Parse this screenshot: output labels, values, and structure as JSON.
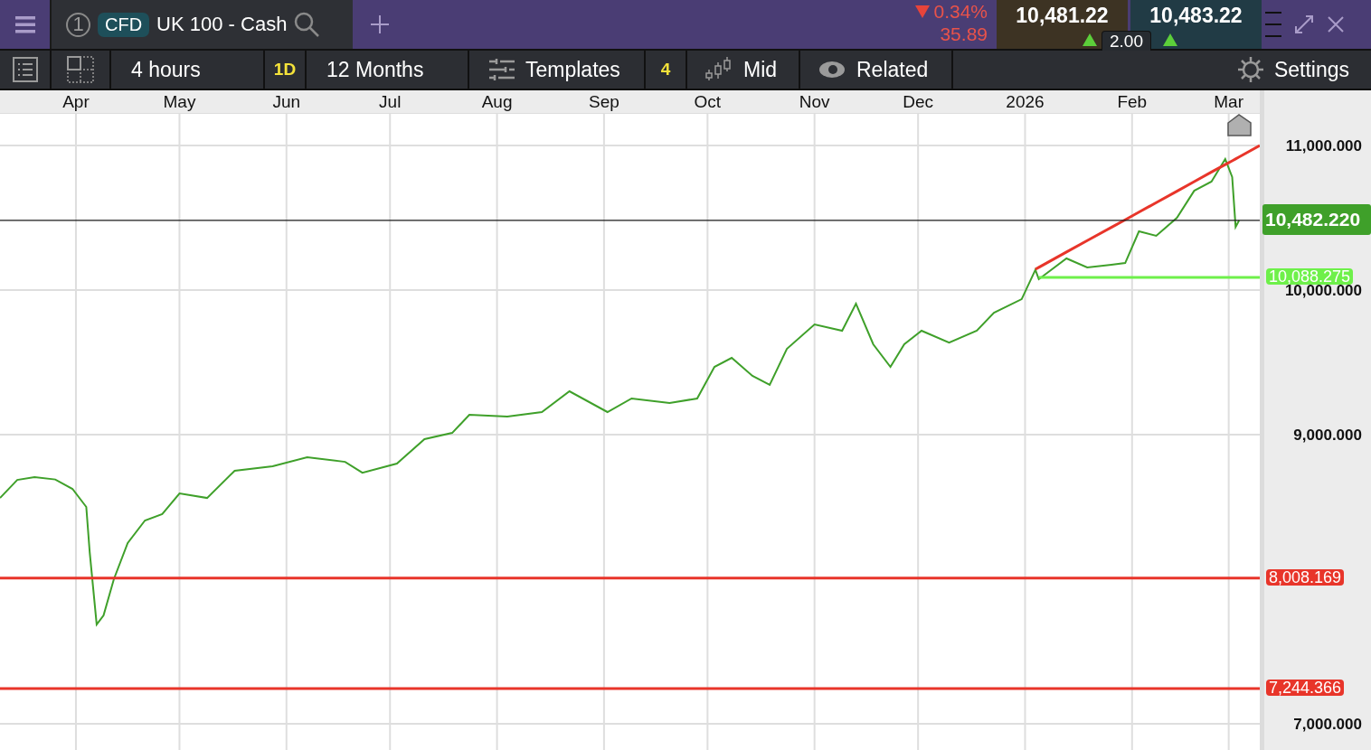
{
  "top_bar": {
    "tab_number": "1",
    "instrument_type": "CFD",
    "instrument_name": "UK 100 - Cash",
    "change_falling": true,
    "change_percent": "0.34%",
    "change_points": "35.89",
    "sell_price": "10,481.22",
    "sell_rising": true,
    "buy_price": "10,483.22",
    "buy_rising": true,
    "spread": "2.00"
  },
  "toolbar": {
    "interval": "4 hours",
    "interval_code": "1D",
    "range": "12 Months",
    "templates": "Templates",
    "indicator_count": "4",
    "price_type": "Mid",
    "related": "Related",
    "settings": "Settings"
  },
  "chart": {
    "chart_data": {
      "type": "line",
      "grid": true,
      "x": [
        "2025-03-10",
        "2025-03-15",
        "2025-03-20",
        "2025-03-26",
        "2025-03-31",
        "2025-04-04",
        "2025-04-05",
        "2025-04-07",
        "2025-04-09",
        "2025-04-12",
        "2025-04-16",
        "2025-04-21",
        "2025-04-26",
        "2025-05-01",
        "2025-05-09",
        "2025-05-17",
        "2025-05-28",
        "2025-06-07",
        "2025-06-18",
        "2025-06-23",
        "2025-07-03",
        "2025-07-11",
        "2025-07-19",
        "2025-07-24",
        "2025-08-04",
        "2025-08-14",
        "2025-08-22",
        "2025-09-02",
        "2025-09-09",
        "2025-09-20",
        "2025-09-28",
        "2025-10-03",
        "2025-10-08",
        "2025-10-14",
        "2025-10-19",
        "2025-10-24",
        "2025-11-01",
        "2025-11-09",
        "2025-11-13",
        "2025-11-18",
        "2025-11-23",
        "2025-11-27",
        "2025-12-02",
        "2025-12-10",
        "2025-12-18",
        "2025-12-23",
        "2025-12-31",
        "2026-01-04",
        "2026-01-05",
        "2026-01-13",
        "2026-01-19",
        "2026-01-26",
        "2026-01-30",
        "2026-02-03",
        "2026-02-08",
        "2026-02-14",
        "2026-02-19",
        "2026-02-24",
        "2026-02-28",
        "2026-03-02",
        "2026-03-03",
        "2026-03-04",
        "2026-03-10"
      ],
      "series": [
        {
          "color": "#3fa02a",
          "values": [
            8562,
            8687,
            8706,
            8690,
            8625,
            8500,
            8187,
            7687,
            7750,
            8000,
            8250,
            8406,
            8450,
            8594,
            8562,
            8750,
            8781,
            8844,
            8812,
            8737,
            8800,
            8969,
            9012,
            9137,
            9125,
            9156,
            9300,
            9156,
            9250,
            9219,
            9250,
            9469,
            9531,
            9406,
            9344,
            9594,
            9762,
            9719,
            9906,
            9625,
            9469,
            9625,
            9719,
            9637,
            9719,
            9844,
            9937,
            10140,
            10075,
            10219,
            10156,
            10175,
            10187,
            10406,
            10375,
            10500,
            10687,
            10750,
            10906,
            10781,
            10437,
            10481,
            null
          ]
        },
        {
          "color": "#e8352a",
          "values": [
            null,
            null,
            null,
            null,
            null,
            null,
            null,
            null,
            null,
            null,
            null,
            null,
            null,
            null,
            null,
            null,
            null,
            null,
            null,
            null,
            null,
            null,
            null,
            null,
            null,
            null,
            null,
            null,
            null,
            null,
            null,
            null,
            null,
            null,
            null,
            null,
            null,
            null,
            null,
            null,
            null,
            null,
            null,
            null,
            null,
            null,
            null,
            10144,
            10157,
            10263,
            10342,
            10434,
            10486,
            10539,
            10605,
            10684,
            10750,
            10816,
            10868,
            10894,
            10907,
            10920,
            11000
          ]
        },
        {
          "name": "10,088.275",
          "color": "#6ef04a",
          "values": [
            null,
            null,
            null,
            null,
            null,
            null,
            null,
            null,
            null,
            null,
            null,
            null,
            null,
            null,
            null,
            null,
            null,
            null,
            null,
            null,
            null,
            null,
            null,
            null,
            null,
            null,
            null,
            null,
            null,
            null,
            null,
            null,
            null,
            null,
            null,
            null,
            null,
            null,
            null,
            null,
            null,
            null,
            null,
            null,
            null,
            null,
            null,
            null,
            10088,
            10088,
            10088,
            10088,
            10088,
            10088,
            10088,
            10088,
            10088,
            10088,
            10088,
            10088,
            10088,
            10088,
            10088
          ]
        }
      ],
      "xlim": [
        "2025-03-10",
        "2026-03-10"
      ],
      "ylim": [
        6812.5,
        11218.75
      ],
      "xticks": [
        {
          "value": "2025-04-01",
          "label": "Apr"
        },
        {
          "value": "2025-05-01",
          "label": "May"
        },
        {
          "value": "2025-06-01",
          "label": "Jun"
        },
        {
          "value": "2025-07-01",
          "label": "Jul"
        },
        {
          "value": "2025-08-01",
          "label": "Aug"
        },
        {
          "value": "2025-09-01",
          "label": "Sep"
        },
        {
          "value": "2025-10-01",
          "label": "Oct"
        },
        {
          "value": "2025-11-01",
          "label": "Nov"
        },
        {
          "value": "2025-12-01",
          "label": "Dec"
        },
        {
          "value": "2026-01-01",
          "label": "2026"
        },
        {
          "value": "2026-02-01",
          "label": "Feb"
        },
        {
          "value": "2026-03-01",
          "label": "Mar"
        }
      ],
      "yticks": [
        {
          "value": 11000,
          "label": "11,000.000"
        },
        {
          "value": 10000,
          "label": "10,000.000"
        },
        {
          "value": 9000,
          "label": "9,000.000"
        },
        {
          "value": 7000,
          "label": "7,000.000"
        }
      ],
      "ref_lines": [
        {
          "axis": "y",
          "value": 10482.22,
          "label": "10,482.220",
          "color": "#1a1a1a"
        },
        {
          "axis": "y",
          "value": 8008.169,
          "label": "8,008.169",
          "color": "#e8352a"
        },
        {
          "axis": "y",
          "value": 7244.366,
          "label": "7,244.366",
          "color": "#e8352a"
        }
      ]
    }
  }
}
